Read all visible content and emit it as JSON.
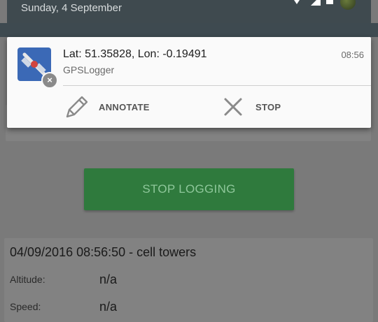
{
  "status_bar": {
    "date": "Sunday, 4 September",
    "icons": [
      "wifi-icon",
      "signal-icon",
      "battery-icon",
      "avatar"
    ]
  },
  "notification": {
    "title": "Lat: 51.35828, Lon: -0.19491",
    "app_name": "GPSLogger",
    "time": "08:56",
    "app_icon": "gpslogger-satellite-icon",
    "badge_icon": "close-icon",
    "actions": [
      {
        "label": "ANNOTATE",
        "icon": "pencil-icon"
      },
      {
        "label": "STOP",
        "icon": "close-icon"
      }
    ]
  },
  "app": {
    "stop_logging_label": "STOP LOGGING",
    "info": {
      "title": "04/09/2016 08:56:50 - cell towers",
      "altitude_label": "Altitude:",
      "altitude_value": "n/a",
      "speed_label": "Speed:",
      "speed_value": "n/a"
    }
  },
  "colors": {
    "scrim": "#7a7a7a",
    "shade_header": "#3f4a4f",
    "stop_button": "#2f7a3d",
    "app_icon_bg": "#3b69b6"
  }
}
